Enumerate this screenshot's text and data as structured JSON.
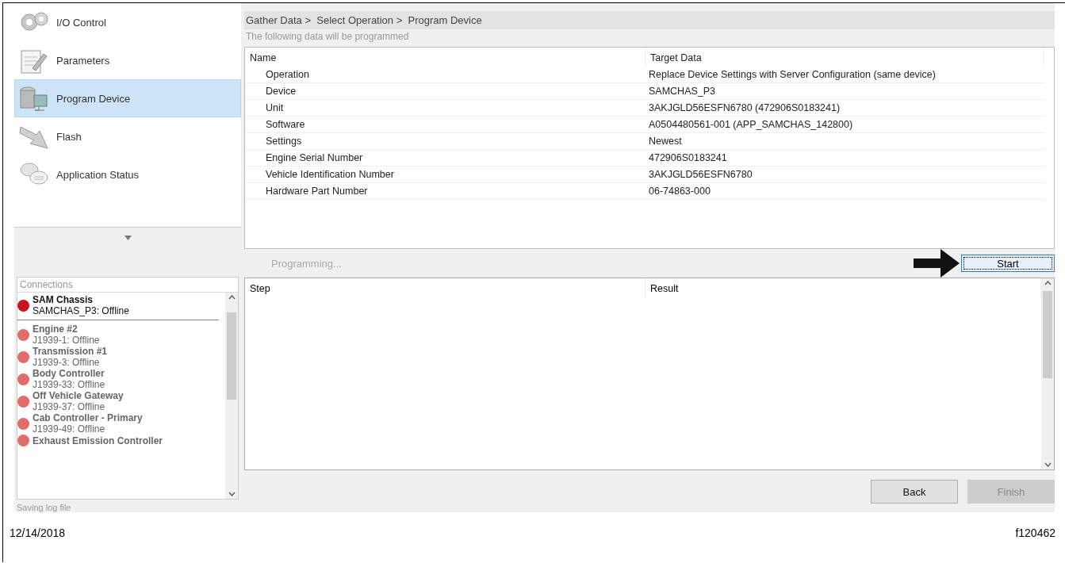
{
  "nav": {
    "items": [
      {
        "label": "I/O Control",
        "kind": "gears",
        "selected": false
      },
      {
        "label": "Parameters",
        "kind": "notepad",
        "selected": false
      },
      {
        "label": "Program Device",
        "kind": "database",
        "selected": true
      },
      {
        "label": "Flash",
        "kind": "arrow",
        "selected": false
      },
      {
        "label": "Application Status",
        "kind": "bubbles",
        "selected": false
      }
    ]
  },
  "connections": {
    "title": "Connections",
    "items": [
      {
        "name": "SAM Chassis",
        "status": "SAMCHAS_P3: Offline",
        "selected": true,
        "color": "#c8141e"
      },
      {
        "name": "Engine #2",
        "status": "J1939-1: Offline",
        "selected": false,
        "color": "#e26b6b"
      },
      {
        "name": "Transmission #1",
        "status": "J1939-3: Offline",
        "selected": false,
        "color": "#e26b6b"
      },
      {
        "name": "Body Controller",
        "status": "J1939-33: Offline",
        "selected": false,
        "color": "#e26b6b"
      },
      {
        "name": "Off Vehicle Gateway",
        "status": "J1939-37: Offline",
        "selected": false,
        "color": "#e26b6b"
      },
      {
        "name": "Cab Controller - Primary",
        "status": "J1939-49: Offline",
        "selected": false,
        "color": "#e26b6b"
      },
      {
        "name": "Exhaust Emission Controller",
        "selected": false,
        "color": "#e26b6b"
      }
    ]
  },
  "status_bar": "Saving log file",
  "breadcrumb": "Gather Data >  Select Operation >  Program Device",
  "subtitle": "The following data will be programmed",
  "data_table": {
    "columns": [
      "Name",
      "Target Data"
    ],
    "rows": [
      [
        "Operation",
        "Replace Device Settings with Server Configuration (same device)"
      ],
      [
        "Device",
        "SAMCHAS_P3"
      ],
      [
        "Unit",
        "3AKJGLD56ESFN6780 (472906S0183241)"
      ],
      [
        "Software",
        "A0504480561-001 (APP_SAMCHAS_142800)"
      ],
      [
        "Settings",
        "Newest"
      ],
      [
        "Engine Serial Number",
        "472906S0183241"
      ],
      [
        "Vehicle Identification Number",
        "3AKJGLD56ESFN6780"
      ],
      [
        "Hardware Part Number",
        "06-74863-000"
      ]
    ]
  },
  "progress_label": "Programming...",
  "start_button": "Start",
  "steps_table": {
    "columns": [
      "Step",
      "Result"
    ]
  },
  "buttons": [
    {
      "label": "Back",
      "disabled": false
    },
    {
      "label": "Finish",
      "disabled": true
    }
  ],
  "footer": {
    "date": "12/14/2018",
    "figure": "f120462"
  }
}
